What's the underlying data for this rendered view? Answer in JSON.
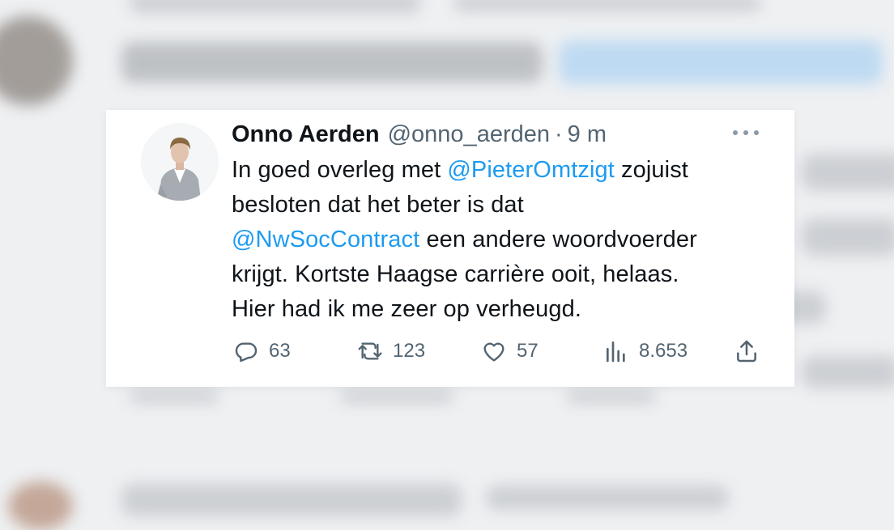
{
  "tweet": {
    "author_name": "Onno Aerden",
    "handle": "@onno_aerden",
    "separator": "·",
    "timestamp": "9 m",
    "lines": [
      [
        {
          "text": "In goed overleg met "
        },
        {
          "text": "@PieterOmtzigt",
          "mention": true
        },
        {
          "text": " zojuist"
        }
      ],
      [
        {
          "text": "besloten dat het beter is dat"
        }
      ],
      [
        {
          "text": "@NwSocContract",
          "mention": true
        },
        {
          "text": " een andere woordvoerder"
        }
      ],
      [
        {
          "text": "krijgt. Kortste Haagse carrière ooit, helaas."
        }
      ],
      [
        {
          "text": "Hier had ik me zeer op verheugd."
        }
      ]
    ],
    "stats": {
      "replies": "63",
      "retweets": "123",
      "likes": "57",
      "views": "8.653"
    }
  },
  "icons": {
    "more": "more-dots-icon",
    "reply": "reply-bubble-icon",
    "retweet": "retweet-icon",
    "like": "heart-icon",
    "views": "views-chart-icon",
    "share": "share-upload-icon"
  },
  "colors": {
    "mention": "#1d9bf0",
    "text": "#0f1419",
    "secondary": "#536471"
  }
}
